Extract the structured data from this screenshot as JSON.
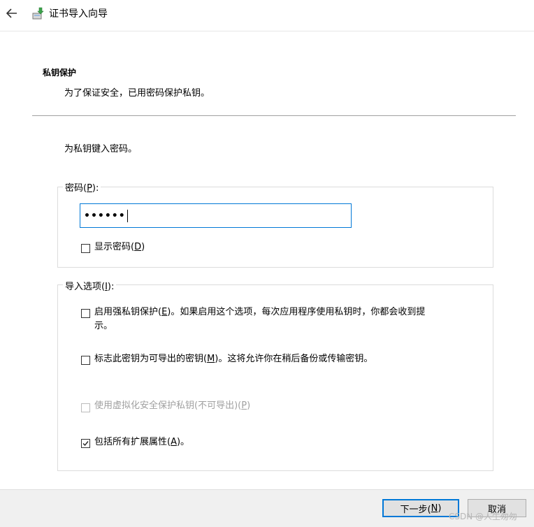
{
  "title_bar": {
    "title": "证书导入向导",
    "back_icon": "arrow-left-icon",
    "app_icon": "certificate-wizard-icon"
  },
  "header": {
    "heading": "私钥保护",
    "description": "为了保证安全，已用密码保护私钥。"
  },
  "prompt": "为私钥键入密码。",
  "password_group": {
    "label_prefix": "密码(",
    "label_key": "P",
    "label_suffix": "):",
    "masked_value": "••••••",
    "show_password": {
      "label_prefix": "显示密码(",
      "label_key": "D",
      "label_suffix": ")",
      "checked": false
    }
  },
  "options_group": {
    "label_prefix": "导入选项(",
    "label_key": "I",
    "label_suffix": "):",
    "options": [
      {
        "line1_prefix": "启用强私钥保护(",
        "key": "E",
        "line1_suffix": ")。如果启用这个选项，每次应用程序使用私钥时，你都会收到提",
        "line2": "示。",
        "checked": false,
        "enabled": true
      },
      {
        "line1_prefix": "标志此密钥为可导出的密钥(",
        "key": "M",
        "line1_suffix": ")。这将允许你在稍后备份或传输密钥。",
        "checked": false,
        "enabled": true
      },
      {
        "line1_prefix": "使用虚拟化安全保护私钥(不可导出)(",
        "key": "P",
        "line1_suffix": ")",
        "checked": false,
        "enabled": false
      },
      {
        "line1_prefix": "包括所有扩展属性(",
        "key": "A",
        "line1_suffix": ")。",
        "checked": true,
        "enabled": true
      }
    ]
  },
  "footer": {
    "next_prefix": "下一步(",
    "next_key": "N",
    "next_suffix": ")",
    "cancel": "取消",
    "watermark": "CSDN @人生匆匆"
  },
  "colors": {
    "focus_blue": "#0078d7",
    "footer_bg": "#f0f0f0",
    "disabled_text": "#a0a0a0"
  }
}
